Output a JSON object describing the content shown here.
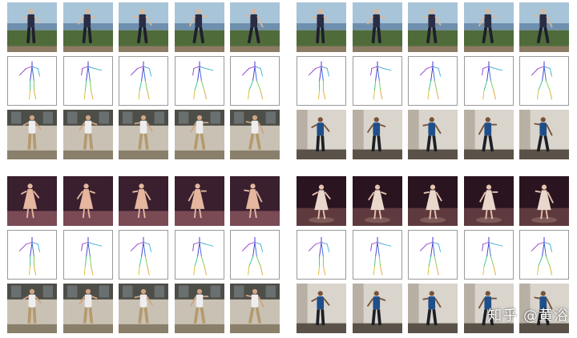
{
  "panels": [
    {
      "name": "top-left",
      "subject": "dancer",
      "source_scene": "seaside",
      "target_scene": "office-dancer"
    },
    {
      "name": "top-right",
      "subject": "dancer",
      "source_scene": "seaside",
      "target_scene": "grey-wall-blue-shirt"
    },
    {
      "name": "bottom-left",
      "subject": "ballet",
      "source_scene": "stage-pink",
      "target_scene": "office-dancer"
    },
    {
      "name": "bottom-right",
      "subject": "ballet",
      "source_scene": "stage-white",
      "target_scene": "grey-wall-blue-shirt"
    }
  ],
  "frames_per_row": 5,
  "colors": {
    "sky": "#a8c4d8",
    "sea": "#6f8fae",
    "stage": "#3a1f2e",
    "stage_floor": "#7a4a55",
    "office_wall": "#c9c2b4",
    "office_floor": "#8a7f6a",
    "grey_wall": "#d9d4cc",
    "grey_floor": "#5a5248",
    "pose_frame": "#9a9a9a"
  },
  "watermark": "知乎 @黄浴"
}
